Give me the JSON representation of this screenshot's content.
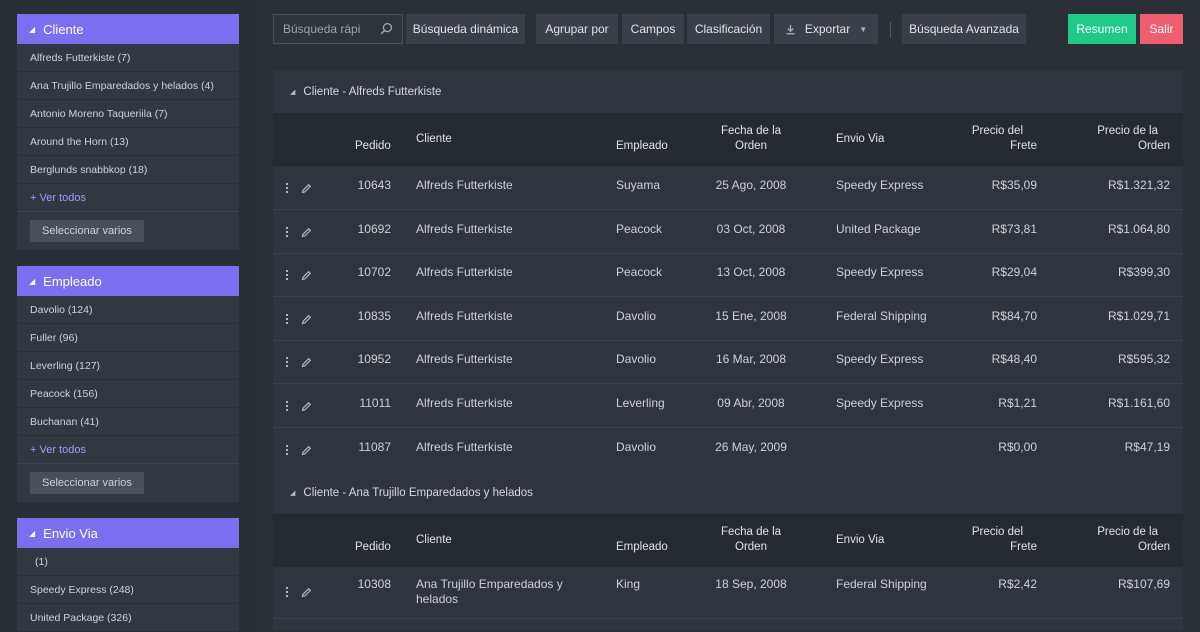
{
  "sidebar": {
    "panels": [
      {
        "title": "Cliente",
        "items": [
          "Alfreds Futterkiste (7)",
          "Ana Trujillo Emparedados y helados (4)",
          "Antonio Moreno Taqueriila (7)",
          "Around the Horn (13)",
          "Berglunds snabbkop (18)"
        ],
        "more": "+ Ver todos",
        "select": "Seleccionar varios"
      },
      {
        "title": "Empleado",
        "items": [
          "Davolio (124)",
          "Fuller (96)",
          "Leverling (127)",
          "Peacock (156)",
          "Buchanan (41)"
        ],
        "more": "+ Ver todos",
        "select": "Seleccionar varios"
      },
      {
        "title": "Envio Via",
        "items": [
          "(1)",
          "Speedy Express (248)",
          "United Package (326)"
        ]
      }
    ]
  },
  "toolbar": {
    "search_placeholder": "Búsqueda rápi",
    "dynamic_search": "Búsqueda dinámica",
    "group_by": "Agrupar por",
    "fields": "Campos",
    "sort": "Clasificación",
    "export": "Exportar",
    "advanced_search": "Búsqueda Avanzada",
    "summary": "Resumen",
    "exit": "Salir"
  },
  "columns": {
    "pedido": "Pedido",
    "cliente": "Cliente",
    "empleado": "Empleado",
    "fecha_1": "Fecha de la",
    "fecha_2": "Orden",
    "envio": "Envio Via",
    "flete_1": "Precio del",
    "flete_2": "Frete",
    "precio_1": "Precio de la",
    "precio_2": "Orden"
  },
  "groups": [
    {
      "title": "Cliente - Alfreds Futterkiste",
      "rows": [
        {
          "pedido": "10643",
          "cliente": "Alfreds Futterkiste",
          "empleado": "Suyama",
          "fecha": "25 Ago, 2008",
          "envio": "Speedy Express",
          "flete": "R$35,09",
          "precio": "R$1.321,32"
        },
        {
          "pedido": "10692",
          "cliente": "Alfreds Futterkiste",
          "empleado": "Peacock",
          "fecha": "03 Oct, 2008",
          "envio": "United Package",
          "flete": "R$73,81",
          "precio": "R$1.064,80"
        },
        {
          "pedido": "10702",
          "cliente": "Alfreds Futterkiste",
          "empleado": "Peacock",
          "fecha": "13 Oct, 2008",
          "envio": "Speedy Express",
          "flete": "R$29,04",
          "precio": "R$399,30"
        },
        {
          "pedido": "10835",
          "cliente": "Alfreds Futterkiste",
          "empleado": "Davolio",
          "fecha": "15 Ene, 2008",
          "envio": "Federal Shipping",
          "flete": "R$84,70",
          "precio": "R$1.029,71"
        },
        {
          "pedido": "10952",
          "cliente": "Alfreds Futterkiste",
          "empleado": "Davolio",
          "fecha": "16 Mar, 2008",
          "envio": "Speedy Express",
          "flete": "R$48,40",
          "precio": "R$595,32"
        },
        {
          "pedido": "11011",
          "cliente": "Alfreds Futterkiste",
          "empleado": "Leverling",
          "fecha": "09 Abr, 2008",
          "envio": "Speedy Express",
          "flete": "R$1,21",
          "precio": "R$1.161,60"
        },
        {
          "pedido": "11087",
          "cliente": "Alfreds Futterkiste",
          "empleado": "Davolio",
          "fecha": "26 May, 2009",
          "envio": "",
          "flete": "R$0,00",
          "precio": "R$47,19"
        }
      ]
    },
    {
      "title": "Cliente - Ana Trujillo Emparedados y helados",
      "rows": [
        {
          "pedido": "10308",
          "cliente_1": "Ana Trujillo Emparedados y",
          "cliente_2": "helados",
          "empleado": "King",
          "fecha": "18 Sep, 2008",
          "envio": "Federal Shipping",
          "flete": "R$2,42",
          "precio": "R$107,69"
        }
      ]
    }
  ]
}
